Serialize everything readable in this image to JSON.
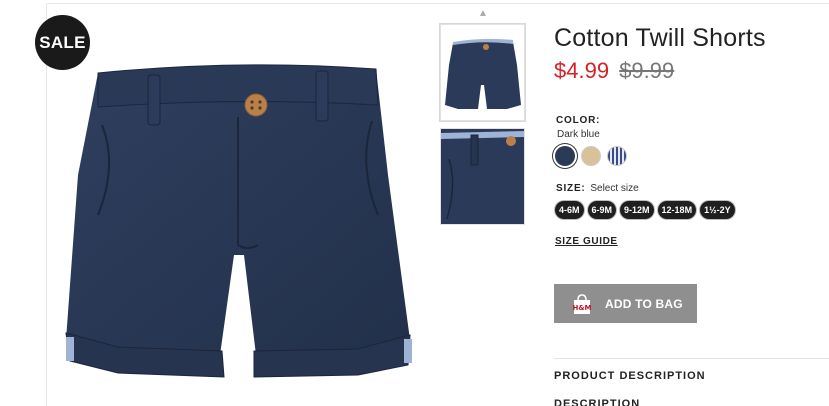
{
  "badge": {
    "label": "SALE"
  },
  "product": {
    "title": "Cotton Twill Shorts",
    "price_sale": "$4.99",
    "price_original": "$9.99"
  },
  "color": {
    "label": "COLOR:",
    "selected": "Dark blue",
    "swatches": [
      {
        "name": "navy",
        "hex": "#2b3a55"
      },
      {
        "name": "beige",
        "hex": "#d9c29a"
      },
      {
        "name": "blue-check",
        "hex": "#3a4c86"
      }
    ]
  },
  "size": {
    "label": "SIZE:",
    "hint": "Select size",
    "options": [
      "4-6M",
      "6-9M",
      "9-12M",
      "12-18M",
      "1½-2Y"
    ]
  },
  "size_guide": "SIZE GUIDE",
  "add_to_bag": {
    "label": "ADD TO BAG",
    "icon": "shopping-bag-icon",
    "color": "#8f8f8f"
  },
  "sections": [
    "PRODUCT DESCRIPTION",
    "DESCRIPTION"
  ],
  "colors": {
    "sale_price": "#d6202a",
    "badge_bg": "#1a1a1a"
  }
}
